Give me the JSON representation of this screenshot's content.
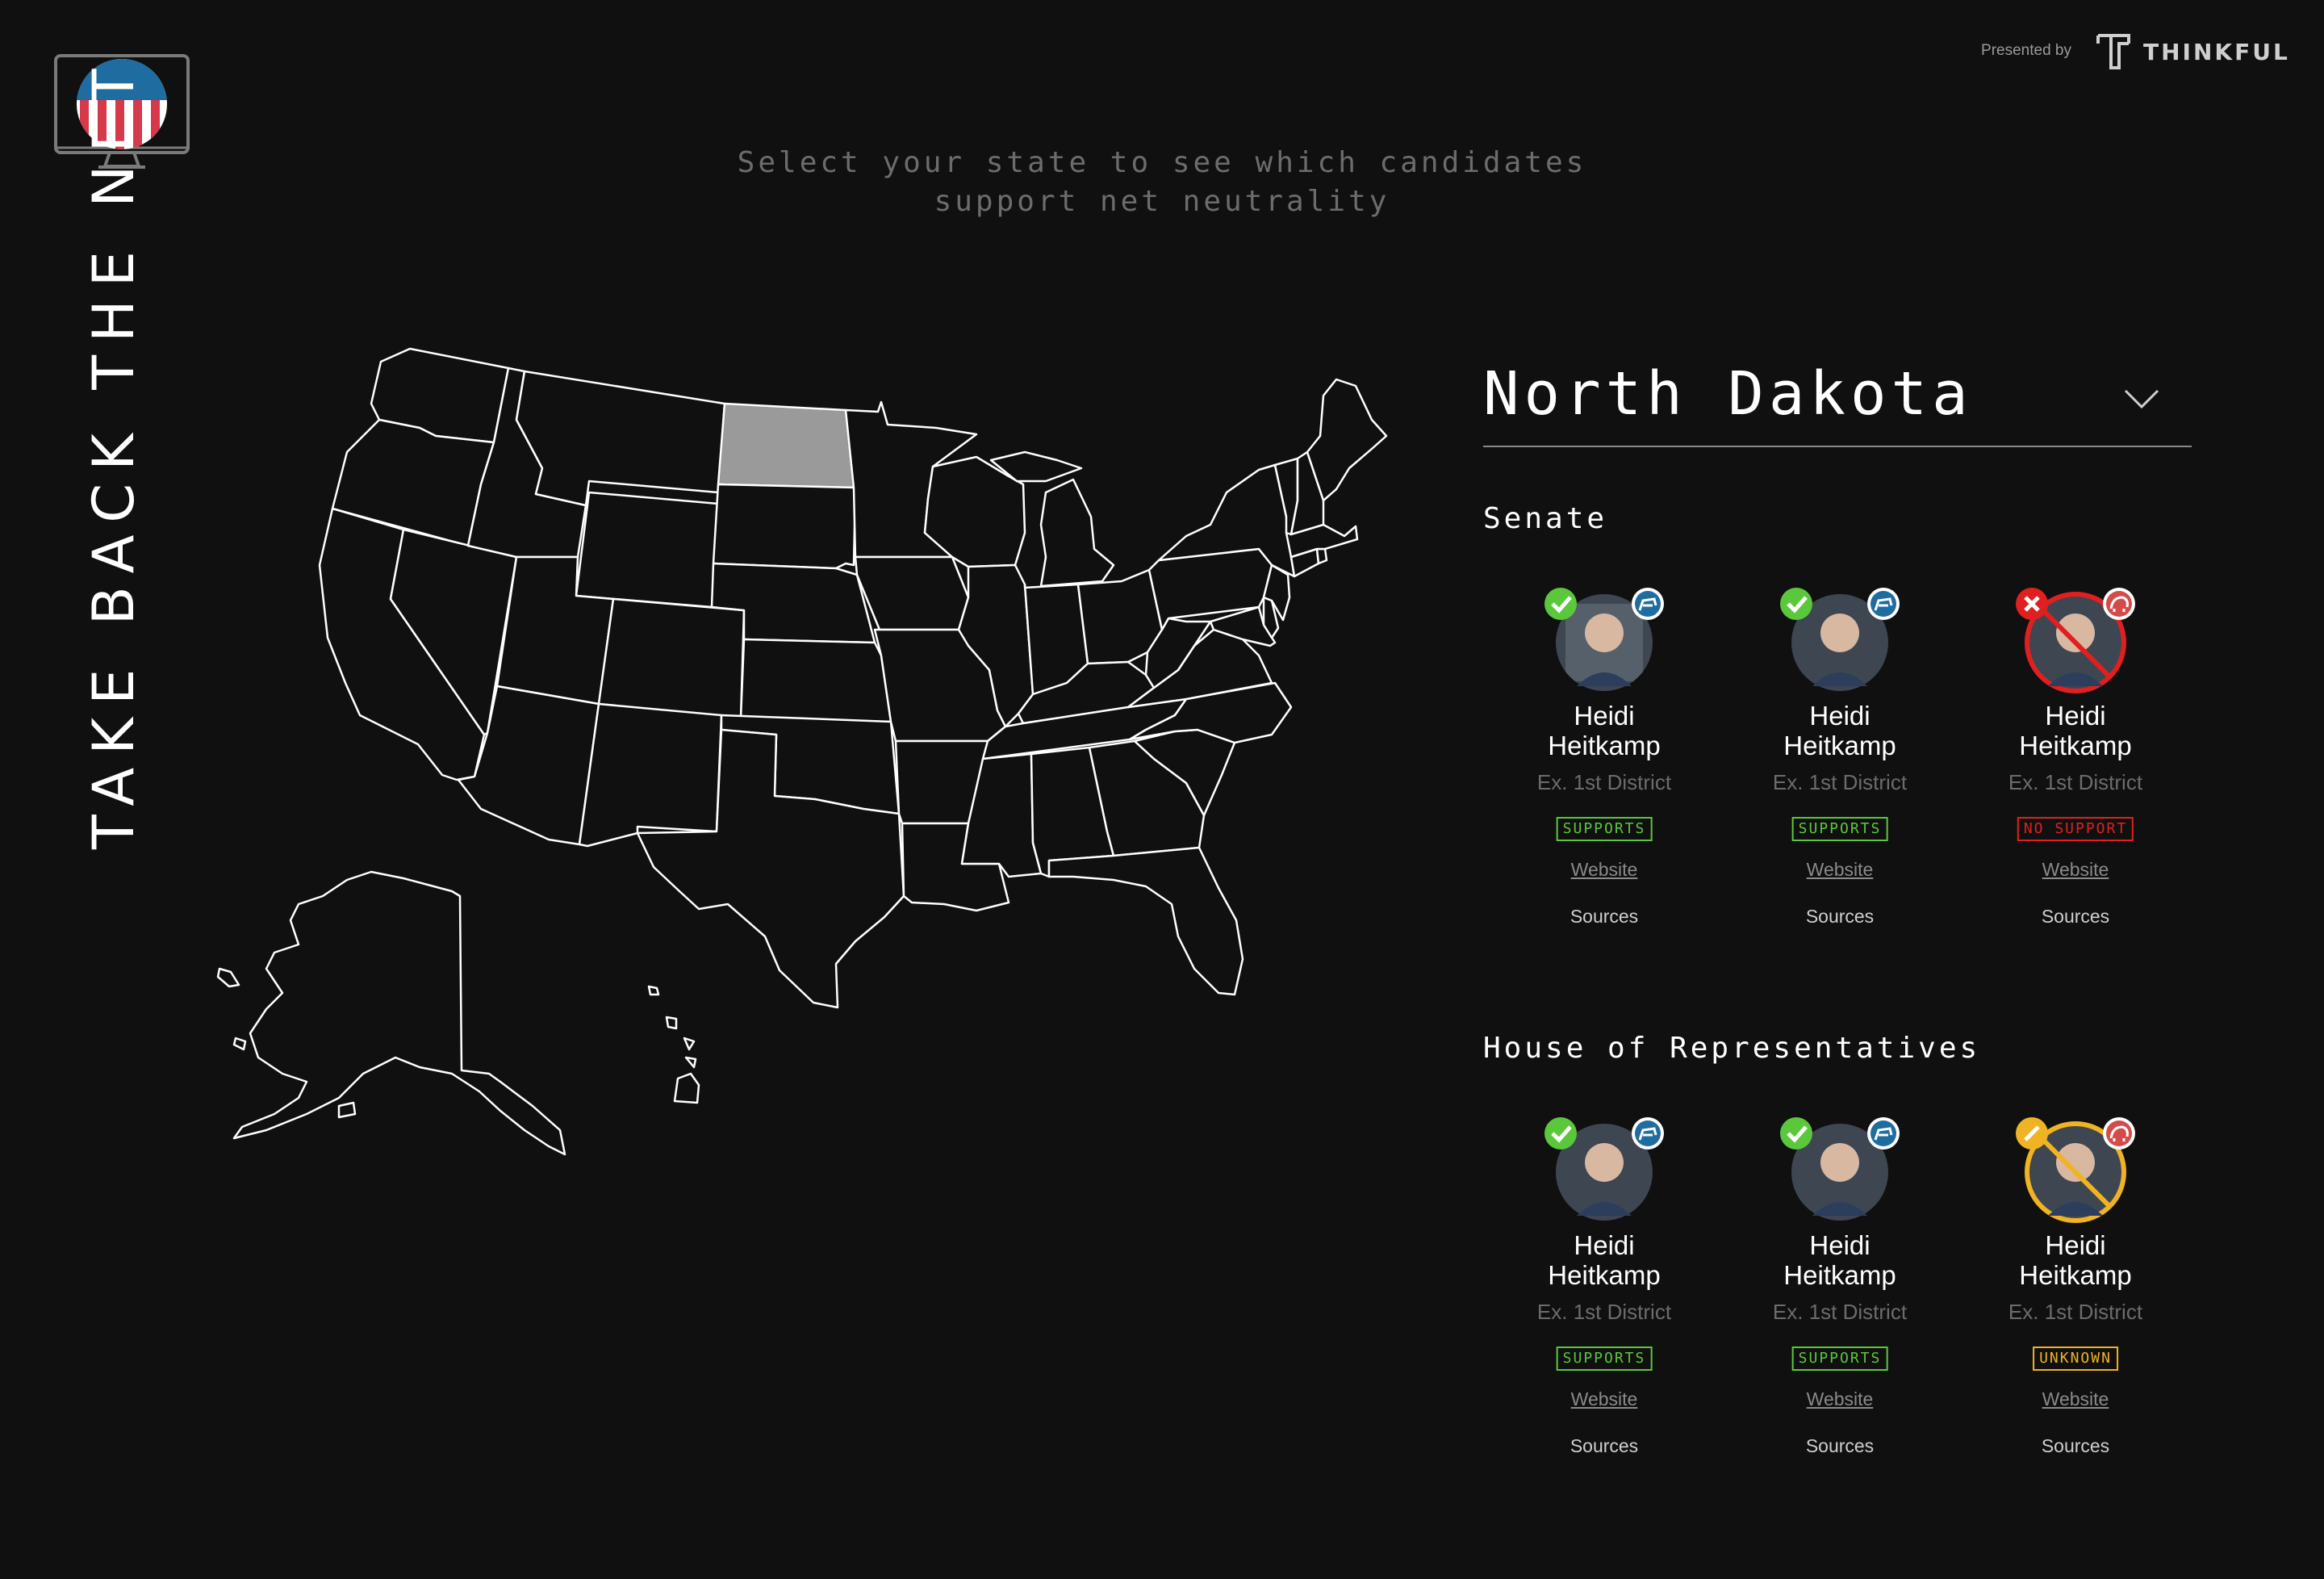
{
  "brand": {
    "title": "TAKE BACK THE NET",
    "presented_by": "Presented by",
    "sponsor": "THINKFUL",
    "accent": "#1f6da0",
    "flag_red": "#d5394a"
  },
  "instruction": {
    "line1": "Select your state to see which candidates",
    "line2": "support net neutrality"
  },
  "map": {
    "selected_state": "North Dakota",
    "selected_fill": "#9a9a9a",
    "stroke": "#ffffff"
  },
  "state_selector": {
    "value": "North Dakota",
    "icon": "chevron-down-icon"
  },
  "senate": {
    "title": "Senate",
    "candidates": [
      {
        "name_first": "Heidi",
        "name_last": "Heitkamp",
        "district": "Ex. 1st District",
        "status": "SUPPORTS",
        "status_color": "#5ac83a",
        "party": "democrat",
        "website": "Website",
        "sources": "Sources"
      },
      {
        "name_first": "Heidi",
        "name_last": "Heitkamp",
        "district": "Ex. 1st District",
        "status": "SUPPORTS",
        "status_color": "#5ac83a",
        "party": "democrat",
        "website": "Website",
        "sources": "Sources"
      },
      {
        "name_first": "Heidi",
        "name_last": "Heitkamp",
        "district": "Ex. 1st District",
        "status": "NO SUPPORT",
        "status_color": "#e02020",
        "party": "republican",
        "website": "Website",
        "sources": "Sources"
      }
    ]
  },
  "house": {
    "title": "House of Representatives",
    "candidates": [
      {
        "name_first": "Heidi",
        "name_last": "Heitkamp",
        "district": "Ex. 1st District",
        "status": "SUPPORTS",
        "status_color": "#5ac83a",
        "party": "democrat",
        "website": "Website",
        "sources": "Sources"
      },
      {
        "name_first": "Heidi",
        "name_last": "Heitkamp",
        "district": "Ex. 1st District",
        "status": "SUPPORTS",
        "status_color": "#5ac83a",
        "party": "democrat",
        "website": "Website",
        "sources": "Sources"
      },
      {
        "name_first": "Heidi",
        "name_last": "Heitkamp",
        "district": "Ex. 1st District",
        "status": "UNKNOWN",
        "status_color": "#f0b323",
        "party": "republican",
        "website": "Website",
        "sources": "Sources"
      }
    ]
  },
  "colors": {
    "democrat_badge": "#1f6da0",
    "republican_badge": "#d34b4b",
    "supports": "#5ac83a",
    "no_support": "#e02020",
    "unknown": "#f0b323"
  }
}
